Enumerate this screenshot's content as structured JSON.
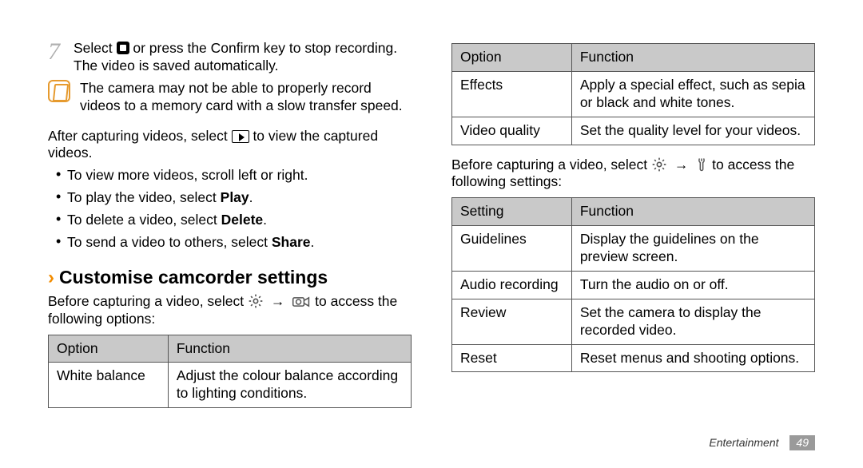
{
  "left": {
    "step_num": "7",
    "step_line1_a": "Select ",
    "step_line1_b": " or press the Confirm key to stop recording.",
    "step_line2": "The video is saved automatically.",
    "note_text": "The camera may not be able to properly record videos to a memory card with a slow transfer speed.",
    "after_capture_a": "After capturing videos, select ",
    "after_capture_b": " to view the captured videos.",
    "bullets": [
      {
        "pre": "To view more videos, scroll left or right.",
        "bold": ""
      },
      {
        "pre": "To play the video, select ",
        "bold": "Play"
      },
      {
        "pre": "To delete a video, select ",
        "bold": "Delete"
      },
      {
        "pre": "To send a video to others, select ",
        "bold": "Share"
      }
    ],
    "section_title": "Customise camcorder settings",
    "options_lead_a": "Before capturing a video, select ",
    "options_lead_b": " to access the following options:",
    "arrow": "→",
    "table": {
      "headers": [
        "Option",
        "Function"
      ],
      "rows": [
        [
          "White balance",
          "Adjust the colour balance according to lighting conditions."
        ]
      ]
    }
  },
  "right": {
    "table1": {
      "headers": [
        "Option",
        "Function"
      ],
      "rows": [
        [
          "Effects",
          "Apply a special effect, such as sepia or black and white tones."
        ],
        [
          "Video quality",
          "Set the quality level for your videos."
        ]
      ]
    },
    "settings_lead_a": "Before capturing a video, select ",
    "settings_lead_b": " to access the following settings:",
    "arrow": "→",
    "table2": {
      "headers": [
        "Setting",
        "Function"
      ],
      "rows": [
        [
          "Guidelines",
          "Display the guidelines on the preview screen."
        ],
        [
          "Audio recording",
          "Turn the audio on or off."
        ],
        [
          "Review",
          "Set the camera to display the recorded video."
        ],
        [
          "Reset",
          "Reset menus and shooting options."
        ]
      ]
    }
  },
  "footer": {
    "section": "Entertainment",
    "page": "49"
  }
}
